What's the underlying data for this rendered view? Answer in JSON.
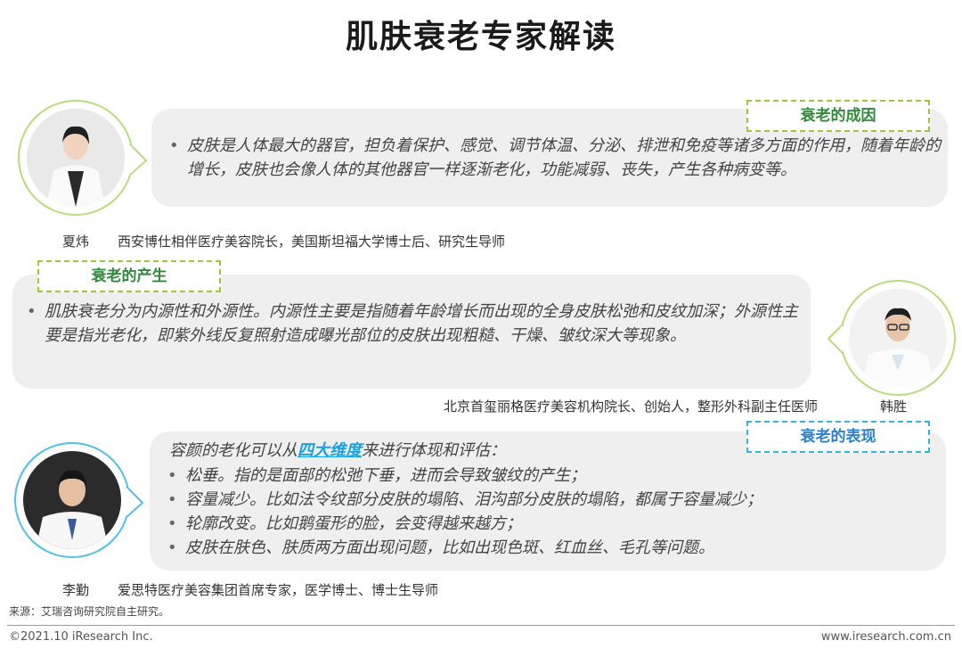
{
  "page": {
    "title": "肌肤衰老专家解读"
  },
  "section1": {
    "tag": "衰老的成因",
    "bullets": [
      "皮肤是人体最大的器官，担负着保护、感觉、调节体温、分泌、排泄和免疫等诸多方面的作用，随着年龄的增长，皮肤也会像人体的其他器官一样逐渐老化，功能减弱、丧失，产生各种病变等。"
    ],
    "expert_name": "夏炜",
    "expert_title": "西安博仕相伴医疗美容院长，美国斯坦福大学博士后、研究生导师"
  },
  "section2": {
    "tag": "衰老的产生",
    "bullets": [
      "肌肤衰老分为内源性和外源性。内源性主要是指随着年龄增长而出现的全身皮肤松弛和皮纹加深；外源性主要是指光老化，即紫外线反复照射造成曝光部位的皮肤出现粗糙、干燥、皱纹深大等现象。"
    ],
    "expert_name": "韩胜",
    "expert_title": "北京首玺丽格医疗美容机构院长、创始人，整形外科副主任医师"
  },
  "section3": {
    "tag": "衰老的表现",
    "intro_before": "容颜的老化可以从",
    "intro_highlight": "四大维度",
    "intro_after": "来进行体现和评估：",
    "bullets": [
      "松垂。指的是面部的松弛下垂，进而会导致皱纹的产生；",
      "容量减少。比如法令纹部分皮肤的塌陷、泪沟部分皮肤的塌陷，都属于容量减少；",
      "轮廓改变。比如鹅蛋形的脸，会变得越来越方；",
      "皮肤在肤色、肤质两方面出现问题，比如出现色斑、红血丝、毛孔等问题。"
    ],
    "expert_name": "李勤",
    "expert_title": "爱思特医疗美容集团首席专家，医学博士、博士生导师"
  },
  "footer": {
    "source": "来源：艾瑞咨询研究院自主研究。",
    "copyright": "©2021.10 iResearch Inc.",
    "website": "www.iresearch.com.cn"
  },
  "colors": {
    "green_tag": "#9cc93a",
    "blue_tag": "#34b5e0",
    "bubble_bg": "#efefef",
    "highlight": "#1aa0e0"
  }
}
